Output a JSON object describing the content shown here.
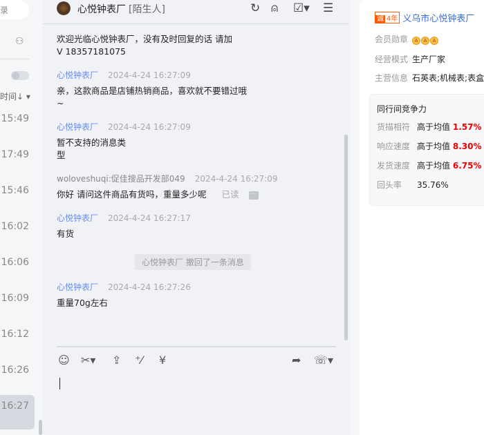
{
  "left": {
    "search_partial": "录",
    "sort_label": "时间↓ ▾",
    "times": [
      "15:49",
      "17:49",
      "15:46",
      "16:02",
      "16:06",
      "16:09",
      "16:12",
      "16:26",
      "16:27"
    ]
  },
  "chat": {
    "title": "心悦钟表厂",
    "tag": "[陌生人]",
    "messages": [
      {
        "sender": "",
        "time": "",
        "text": "欢迎光临心悦钟表厂，没有及时回复的话 请加\nV  18357181075"
      },
      {
        "sender": "心悦钟表厂",
        "time": "2024-4-24 16:27:09",
        "text": "亲，这款商品是店铺热销商品，喜欢就不要错过哦\n~"
      },
      {
        "sender": "心悦钟表厂",
        "time": "2024-4-24 16:27:09",
        "text": "暂不支持的消息类\n型"
      },
      {
        "sender": "woloveshuqi:促佳搜品开发部049",
        "time": "2024-4-24 16:27:09",
        "text": "你好 请问这件商品有货吗，重量多少呢",
        "status": "已读"
      },
      {
        "sender": "心悦钟表厂",
        "time": "2024-4-24 16:27:17",
        "text": "有货"
      },
      {
        "sender": "心悦钟表厂",
        "time": "2024-4-24 16:27:26",
        "text": "重量70g左右"
      }
    ],
    "recall_notice": "心悦钟表厂 撤回了一条消息"
  },
  "right": {
    "badge_icon": "诚",
    "years": "4年",
    "company": "义乌市心悦钟表厂",
    "medal_label": "会员勋章",
    "mode_label": "经营模式",
    "mode": "生产厂家",
    "main_label": "主营信息",
    "main": "石英表;机械表;表盒",
    "compete_title": "同行间竞争力",
    "metrics": [
      {
        "label": "货描相符",
        "prefix": "高于均值",
        "value": "1.57%"
      },
      {
        "label": "响应速度",
        "prefix": "高于均值",
        "value": "8.30%"
      },
      {
        "label": "发货速度",
        "prefix": "高于均值",
        "value": "6.75%"
      }
    ],
    "repeat_label": "回头率",
    "repeat_value": "35.76%"
  }
}
